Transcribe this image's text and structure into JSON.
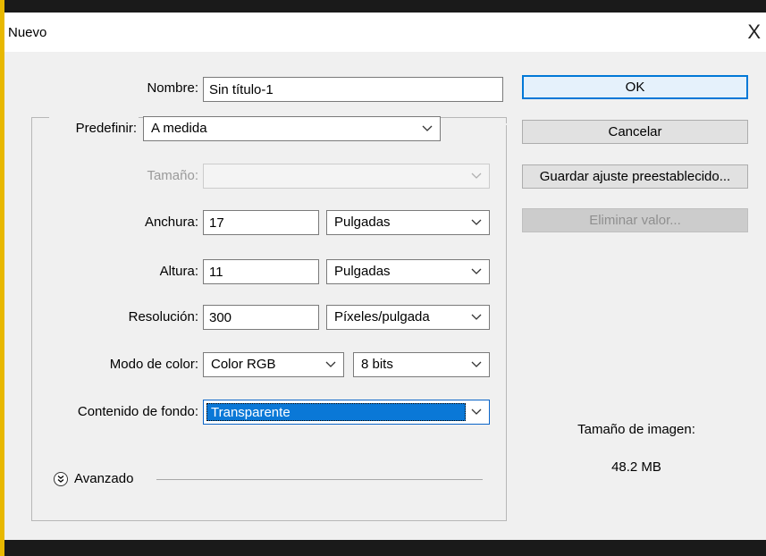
{
  "dialog": {
    "title": "Nuevo",
    "close_glyph": "X"
  },
  "form": {
    "nombre": {
      "label": "Nombre:",
      "value": "Sin título-1"
    },
    "predefinir": {
      "label": "Predefinir:",
      "value": "A medida"
    },
    "tamano": {
      "label": "Tamaño:",
      "value": ""
    },
    "anchura": {
      "label": "Anchura:",
      "value": "17",
      "unit": "Pulgadas"
    },
    "altura": {
      "label": "Altura:",
      "value": "11",
      "unit": "Pulgadas"
    },
    "resolucion": {
      "label": "Resolución:",
      "value": "300",
      "unit": "Píxeles/pulgada"
    },
    "modo_color": {
      "label": "Modo de color:",
      "value": "Color RGB",
      "bits": "8 bits"
    },
    "contenido_fondo": {
      "label": "Contenido de fondo:",
      "value": "Transparente"
    },
    "avanzado": {
      "label": "Avanzado"
    }
  },
  "buttons": {
    "ok": "OK",
    "cancelar": "Cancelar",
    "guardar": "Guardar ajuste preestablecido...",
    "eliminar": "Eliminar valor..."
  },
  "info": {
    "tamano_label": "Tamaño de imagen:",
    "tamano_value": "48.2 MB"
  },
  "colors": {
    "accent": "#0078d7",
    "selection": "#0a78d7",
    "edge": "#e8b800"
  }
}
